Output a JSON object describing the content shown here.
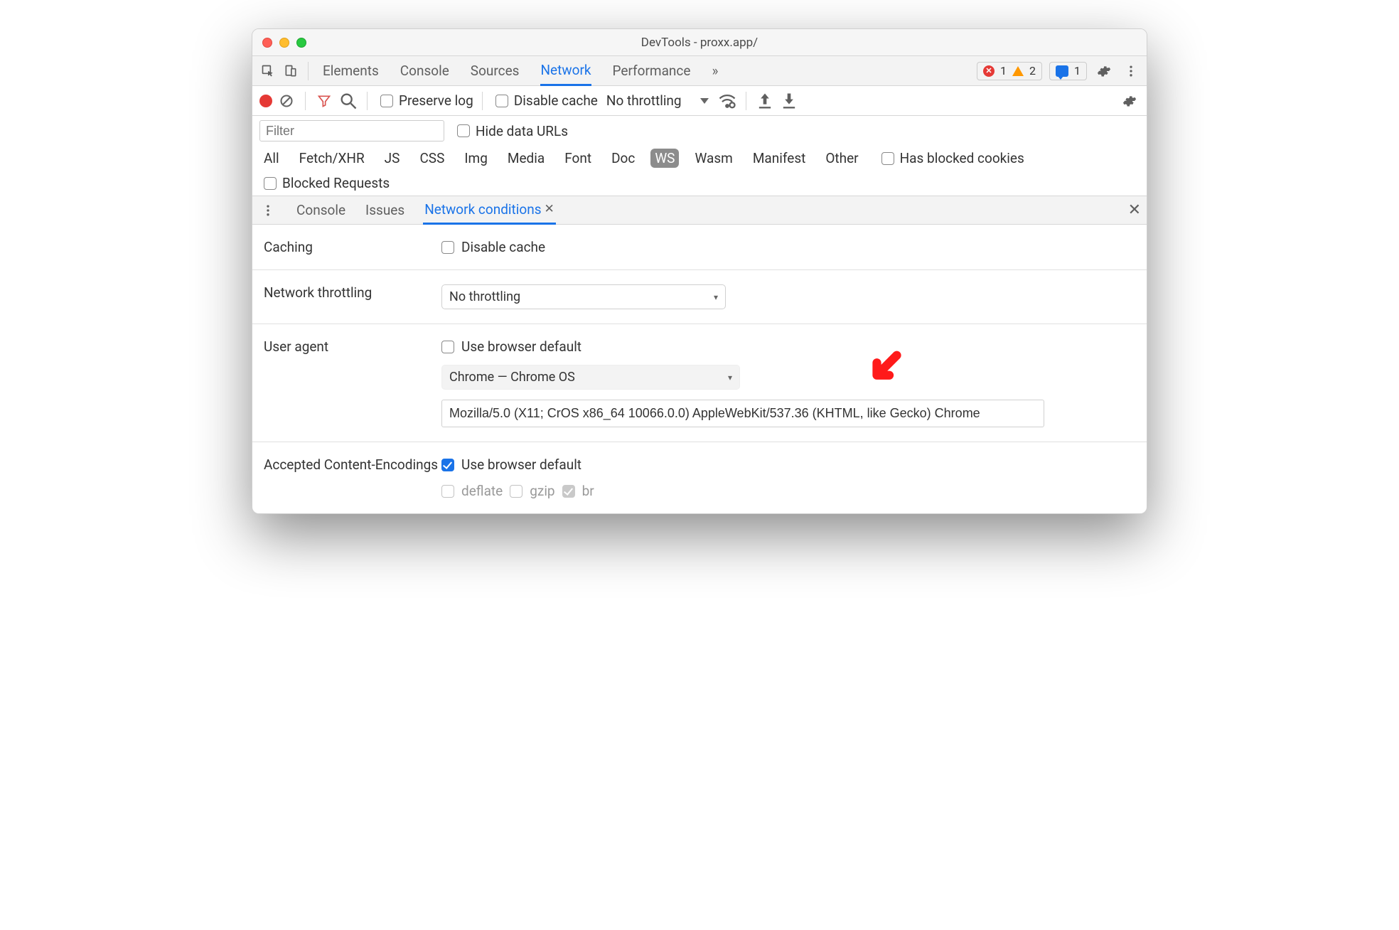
{
  "window": {
    "title": "DevTools - proxx.app/"
  },
  "tabs": {
    "items": [
      "Elements",
      "Console",
      "Sources",
      "Network",
      "Performance"
    ],
    "active": "Network",
    "overflow_glyph": "»"
  },
  "status": {
    "errors": "1",
    "warnings": "2",
    "messages": "1"
  },
  "networkToolbar": {
    "preserve_log": "Preserve log",
    "disable_cache": "Disable cache",
    "throttling": "No throttling"
  },
  "filter": {
    "placeholder": "Filter",
    "hide_data_urls": "Hide data URLs",
    "types": [
      "All",
      "Fetch/XHR",
      "JS",
      "CSS",
      "Img",
      "Media",
      "Font",
      "Doc",
      "WS",
      "Wasm",
      "Manifest",
      "Other"
    ],
    "active_type": "WS",
    "has_blocked_cookies": "Has blocked cookies",
    "blocked_requests": "Blocked Requests"
  },
  "drawer": {
    "tabs": [
      "Console",
      "Issues",
      "Network conditions"
    ],
    "active": "Network conditions"
  },
  "conditions": {
    "caching_label": "Caching",
    "caching_disable": "Disable cache",
    "throttling_label": "Network throttling",
    "throttling_value": "No throttling",
    "ua_label": "User agent",
    "ua_use_default": "Use browser default",
    "ua_select": "Chrome — Chrome OS",
    "ua_string": "Mozilla/5.0 (X11; CrOS x86_64 10066.0.0) AppleWebKit/537.36 (KHTML, like Gecko) Chrome",
    "enc_label": "Accepted Content-Encodings",
    "enc_use_default": "Use browser default",
    "enc_options": [
      "deflate",
      "gzip",
      "br"
    ]
  }
}
